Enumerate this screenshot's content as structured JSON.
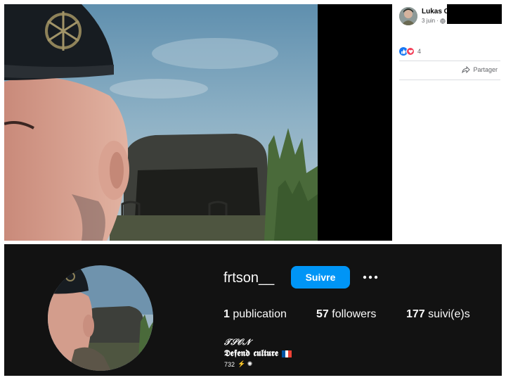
{
  "facebook": {
    "author_name": "Lukas C",
    "post_date": "3 juin",
    "meta_separator": "·",
    "reaction_count": "4",
    "share_label": "Partager",
    "icons": {
      "privacy": "globe-icon",
      "like": "like-icon",
      "love": "love-icon",
      "share": "share-icon"
    },
    "colors": {
      "like": "#1877f2",
      "love": "#f33e58",
      "meta_text": "#65676b"
    }
  },
  "instagram": {
    "username": "frtson__",
    "follow_label": "Suivre",
    "stats": [
      {
        "count": "1",
        "label": "publication"
      },
      {
        "count": "57",
        "label": "followers"
      },
      {
        "count": "177",
        "label": "suivi(e)s"
      }
    ],
    "bio": {
      "line1": "𝒯𝒮𝒪𝒩",
      "line2": "𝕯𝖊𝖋𝖊𝖓𝖉 𝖈𝖚𝖑𝖙𝖚𝖗𝖊",
      "line3_number": "732",
      "line3_symbols": "⚡ ✺"
    },
    "icons": {
      "more": "more-options-icon",
      "flag": "france-flag-icon"
    },
    "colors": {
      "background": "#121212",
      "follow_button": "#0095f6",
      "text": "#fafafa"
    }
  }
}
